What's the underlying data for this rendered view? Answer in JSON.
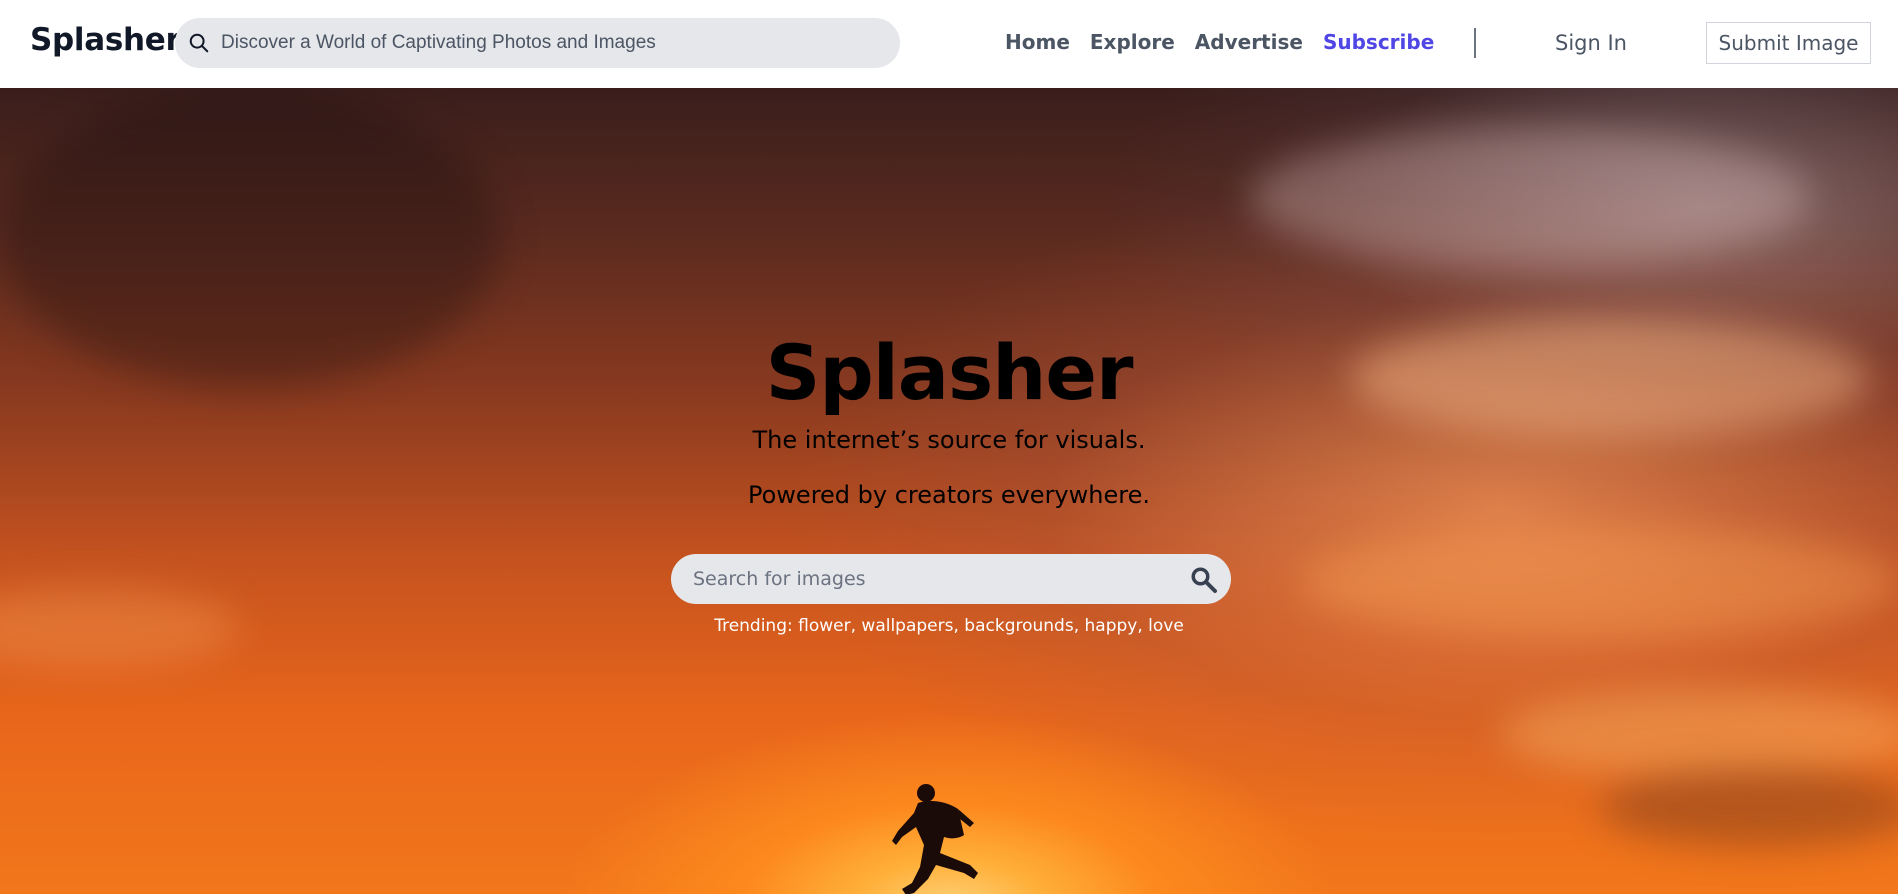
{
  "header": {
    "logo": "Splasher",
    "search": {
      "placeholder": "Discover a World of Captivating Photos and Images",
      "icon": "search-icon"
    },
    "nav": [
      {
        "label": "Home"
      },
      {
        "label": "Explore"
      },
      {
        "label": "Advertise"
      },
      {
        "label": "Subscribe",
        "accent": true
      }
    ],
    "sign_in": "Sign In",
    "submit_button": "Submit Image"
  },
  "hero": {
    "title": "Splasher",
    "subtitle_1": "The internet’s source for visuals.",
    "subtitle_2": "Powered by creators everywhere.",
    "search": {
      "placeholder": "Search for images",
      "icon": "search-icon"
    },
    "trending_label": "Trending:",
    "trending_items": "flower, wallpapers, backgrounds, happy, love"
  },
  "colors": {
    "accent": "#4f46e5",
    "nav_text": "#4b5563",
    "logo_text": "#111827",
    "search_bg": "#e5e7eb"
  }
}
